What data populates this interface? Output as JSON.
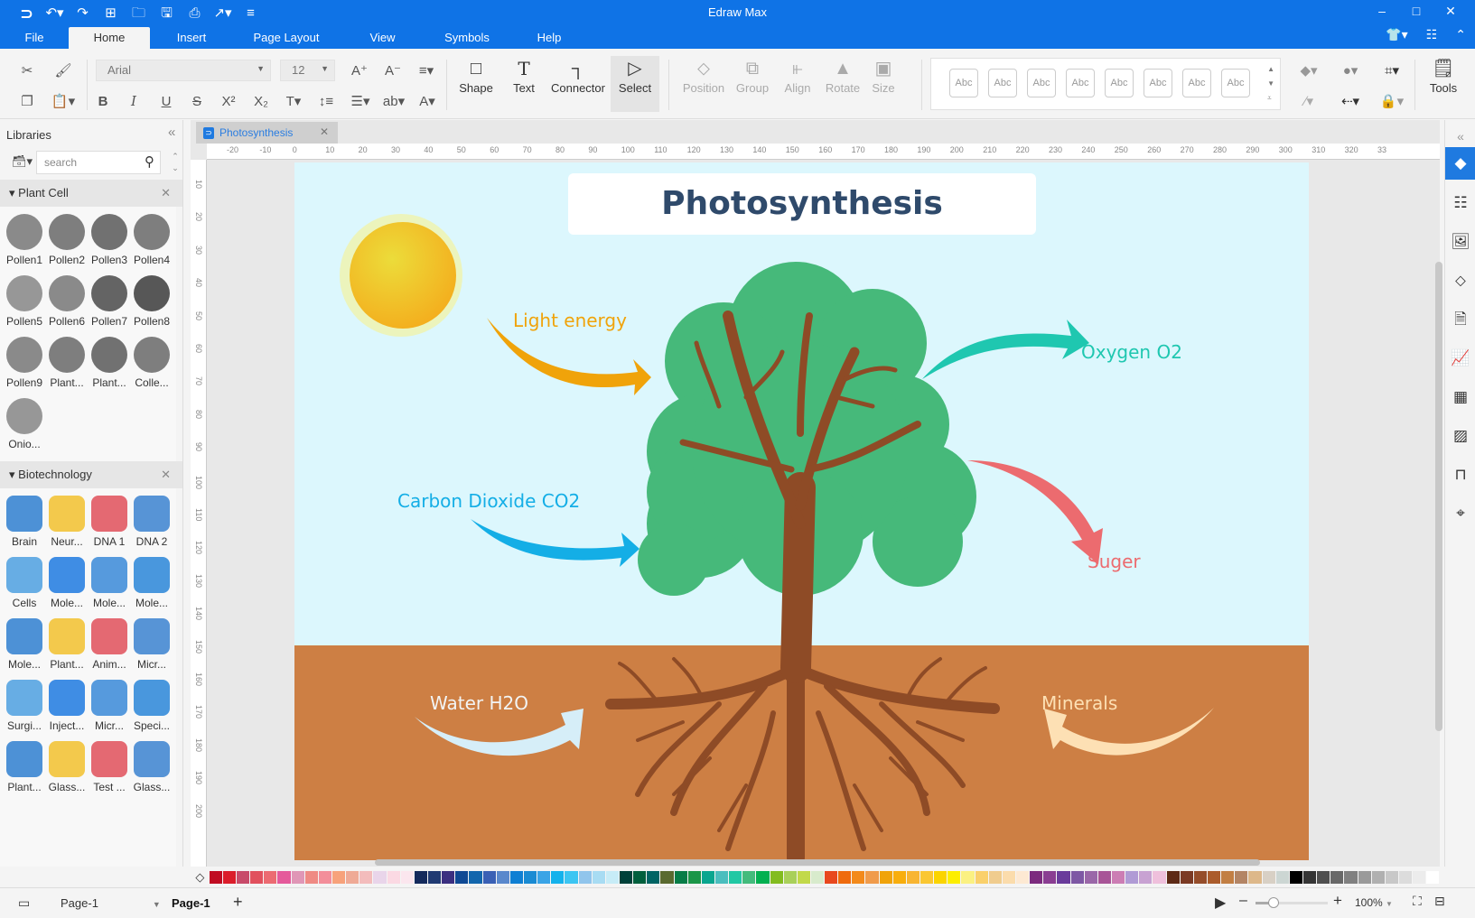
{
  "app": {
    "title": "Edraw Max"
  },
  "quick_access": [
    "logo-icon",
    "undo-icon",
    "redo-icon",
    "new-icon",
    "open-icon",
    "save-icon",
    "print-icon",
    "export-icon",
    "customize-icon"
  ],
  "menu": {
    "items": [
      "File",
      "Home",
      "Insert",
      "Page Layout",
      "View",
      "Symbols",
      "Help"
    ],
    "active": "Home"
  },
  "ribbon": {
    "font_name": "Arial",
    "font_size": "12",
    "tools": {
      "shape": "Shape",
      "text": "Text",
      "connector": "Connector",
      "select": "Select",
      "position": "Position",
      "group": "Group",
      "align": "Align",
      "rotate": "Rotate",
      "size": "Size",
      "tools": "Tools"
    },
    "style_samples": [
      "Abc",
      "Abc",
      "Abc",
      "Abc",
      "Abc",
      "Abc",
      "Abc",
      "Abc"
    ]
  },
  "libraries": {
    "title": "Libraries",
    "search_placeholder": "search",
    "sections": [
      {
        "name": "Plant Cell",
        "items": [
          "Pollen1",
          "Pollen2",
          "Pollen3",
          "Pollen4",
          "Pollen5",
          "Pollen6",
          "Pollen7",
          "Pollen8",
          "Pollen9",
          "Plant...",
          "Plant...",
          "Colle...",
          "Onio..."
        ]
      },
      {
        "name": "Biotechnology",
        "items": [
          "Brain",
          "Neur...",
          "DNA 1",
          "DNA 2",
          "Cells",
          "Mole...",
          "Mole...",
          "Mole...",
          "Mole...",
          "Plant...",
          "Anim...",
          "Micr...",
          "Surgi...",
          "Inject...",
          "Micr...",
          "Speci...",
          "Plant...",
          "Glass...",
          "Test ...",
          "Glass..."
        ]
      }
    ]
  },
  "document": {
    "tab": "Photosynthesis",
    "ruler_h": [
      "-20",
      "-10",
      "0",
      "10",
      "20",
      "30",
      "40",
      "50",
      "60",
      "70",
      "80",
      "90",
      "100",
      "110",
      "120",
      "130",
      "140",
      "150",
      "160",
      "170",
      "180",
      "190",
      "200",
      "210",
      "220",
      "230",
      "240",
      "250",
      "260",
      "270",
      "280",
      "290",
      "300",
      "310",
      "320",
      "33"
    ],
    "ruler_v": [
      "10",
      "20",
      "30",
      "40",
      "50",
      "60",
      "70",
      "80",
      "90",
      "100",
      "110",
      "120",
      "130",
      "140",
      "150",
      "160",
      "170",
      "180",
      "190",
      "200"
    ]
  },
  "diagram": {
    "title": "Photosynthesis",
    "labels": {
      "light": "Light energy",
      "oxygen": "Oxygen O2",
      "co2": "Carbon Dioxide CO2",
      "sugar": "Suger",
      "water": "Water H2O",
      "minerals": "Minerals"
    },
    "colors": {
      "sky": "#dcf7fd",
      "soil": "#cd7f44",
      "leaves": "#46b97a",
      "trunk": "#8e4b26",
      "light": "#f0a30a",
      "oxygen": "#1fc7b0",
      "co2": "#14aee6",
      "sugar": "#ec6b6f",
      "water": "#d6eef8",
      "minerals": "#fde0b4",
      "title": "#2f4a6b"
    }
  },
  "palette": [
    "#c00c22",
    "#db1d2a",
    "#c84b6a",
    "#e1505d",
    "#ec6b72",
    "#e55a9b",
    "#e096b6",
    "#ef8a84",
    "#f38e9a",
    "#f7a27b",
    "#efaa96",
    "#f3bcbc",
    "#e9d5ea",
    "#fbd9e3",
    "#fbe6ee",
    "#142a5c",
    "#203a72",
    "#3b2f80",
    "#0f4994",
    "#1366ad",
    "#3a60b5",
    "#5a88cc",
    "#0f7fd3",
    "#1a8bd3",
    "#3aa4e6",
    "#14b2ec",
    "#3cc5f2",
    "#91c5ec",
    "#a8dcf3",
    "#c7ecf7",
    "#00413a",
    "#005f3d",
    "#006464",
    "#5a6a30",
    "#077d47",
    "#1b9648",
    "#09a68f",
    "#4bbebe",
    "#22c8a4",
    "#43bb7c",
    "#03b051",
    "#83bc1f",
    "#a9d05a",
    "#c2d94a",
    "#d8ebcc",
    "#e8481e",
    "#ef6b0d",
    "#f38a1b",
    "#f09b4b",
    "#f0a30a",
    "#f8ae0d",
    "#f8b532",
    "#fac732",
    "#fbd400",
    "#fdee00",
    "#fbf182",
    "#fad06b",
    "#f0cc8e",
    "#fbdcac",
    "#fde9d3",
    "#7c2b7e",
    "#8a3d92",
    "#6a3b9b",
    "#7e58a4",
    "#9a67a8",
    "#a85597",
    "#cc7db4",
    "#b09bd5",
    "#c8a2d2",
    "#efc0dc",
    "#5d2a16",
    "#7b3a24",
    "#954d2a",
    "#ab5c2c",
    "#c27f44",
    "#b38565",
    "#ddb88a",
    "#d8d0c5",
    "#ccd6d3",
    "#000000",
    "#353535",
    "#4f4f4f",
    "#686868",
    "#808080",
    "#9a9a9a",
    "#b0b0b0",
    "#c8c8c8",
    "#dcdcdc",
    "#ececec",
    "#ffffff"
  ],
  "statusbar": {
    "page_select": "Page-1",
    "page_tab": "Page-1",
    "zoom": "100%",
    "zoom_level_percent": 100
  }
}
